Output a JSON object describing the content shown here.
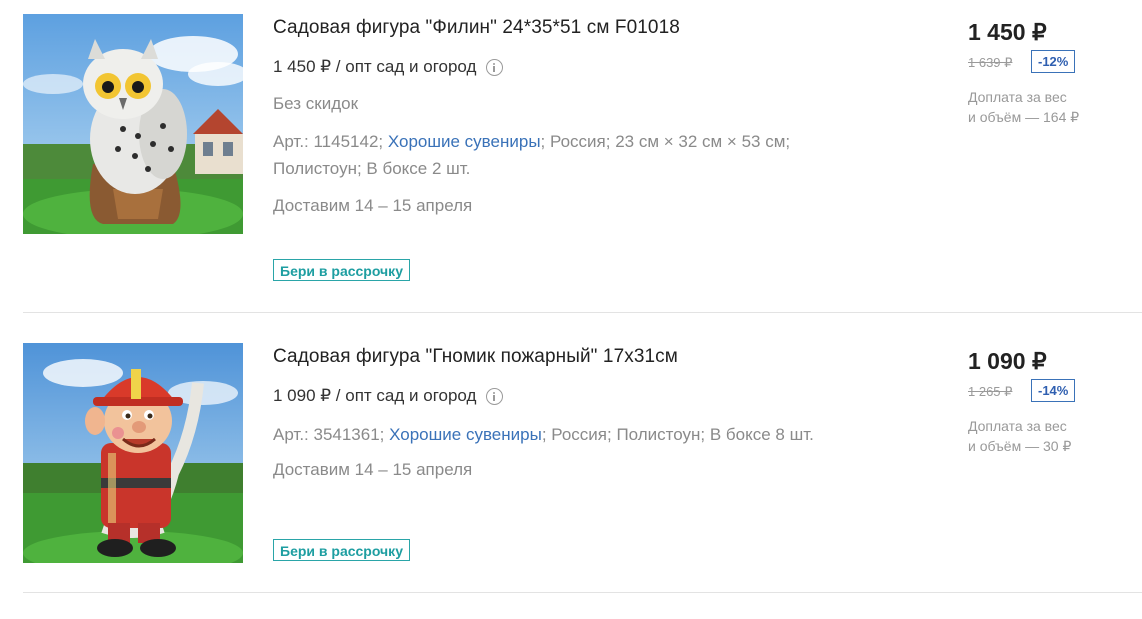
{
  "products": [
    {
      "title": "Садовая фигура \"Филин\" 24*35*51 см F01018",
      "price_line": "1 450 ₽ / опт сад и огород",
      "no_discounts": "Без скидок",
      "specs_prefix": "Арт.: 1145142; ",
      "brand": "Хорошие сувениры",
      "specs_line1_suffix": "; Россия; 23 см × 32 см × 53 см;",
      "specs_line2": "Полистоун; В боксе 2 шт.",
      "delivery": "Доставим 14 – 15 апреля",
      "installment_label": "Бери в рассрочку",
      "price": "1 450 ₽",
      "old_price": "1 639 ₽",
      "discount": "-12%",
      "extra_fee_line1": "Доплата за вес",
      "extra_fee_line2": "и объём — 164 ₽",
      "image_icon": "owl-figurine-photo"
    },
    {
      "title": "Садовая фигура \"Гномик пожарный\" 17х31см",
      "price_line": "1 090 ₽ / опт сад и огород",
      "specs_prefix": "Арт.: 3541361; ",
      "brand": "Хорошие сувениры",
      "specs_suffix": "; Россия; Полистоун; В боксе 8 шт.",
      "delivery": "Доставим 14 – 15 апреля",
      "installment_label": "Бери в рассрочку",
      "price": "1 090 ₽",
      "old_price": "1 265 ₽",
      "discount": "-14%",
      "extra_fee_line1": "Доплата за вес",
      "extra_fee_line2": "и объём — 30 ₽",
      "image_icon": "fireman-gnome-figurine-photo"
    }
  ],
  "colors": {
    "link": "#3a72b8",
    "installment": "#1e9ea1",
    "discount_border": "#3a72b8",
    "muted_text": "#8a8a8a"
  }
}
